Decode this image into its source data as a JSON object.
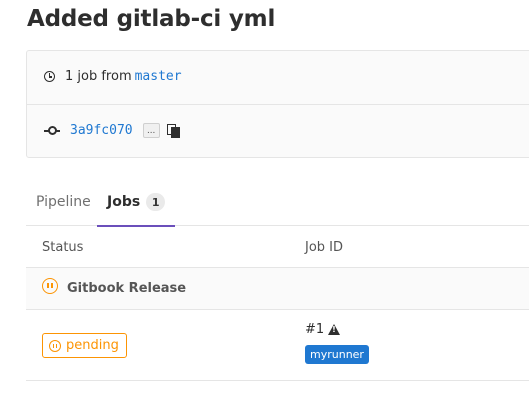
{
  "page": {
    "title": "Added gitlab-ci yml"
  },
  "info": {
    "jobs_summary": "1 job from",
    "branch": "master",
    "commit_sha": "3a9fc070",
    "ellipsis_label": "...",
    "icons": [
      "clock-icon",
      "commit-icon",
      "copy-icon"
    ]
  },
  "tabs": [
    {
      "label": "Pipeline",
      "active": false
    },
    {
      "label": "Jobs",
      "active": true,
      "count": "1"
    }
  ],
  "table": {
    "headers": {
      "status": "Status",
      "job_id": "Job ID"
    },
    "stage": {
      "name": "Gitbook Release",
      "status_icon": "pending-icon"
    },
    "job": {
      "status": "pending",
      "id": "#1",
      "warning_icon": "warning-icon",
      "tag": "myrunner"
    }
  },
  "colors": {
    "link": "#1f78d1",
    "pending": "#fc9403",
    "active_tab": "#6b4fbb",
    "tag_bg": "#1f78d1"
  }
}
